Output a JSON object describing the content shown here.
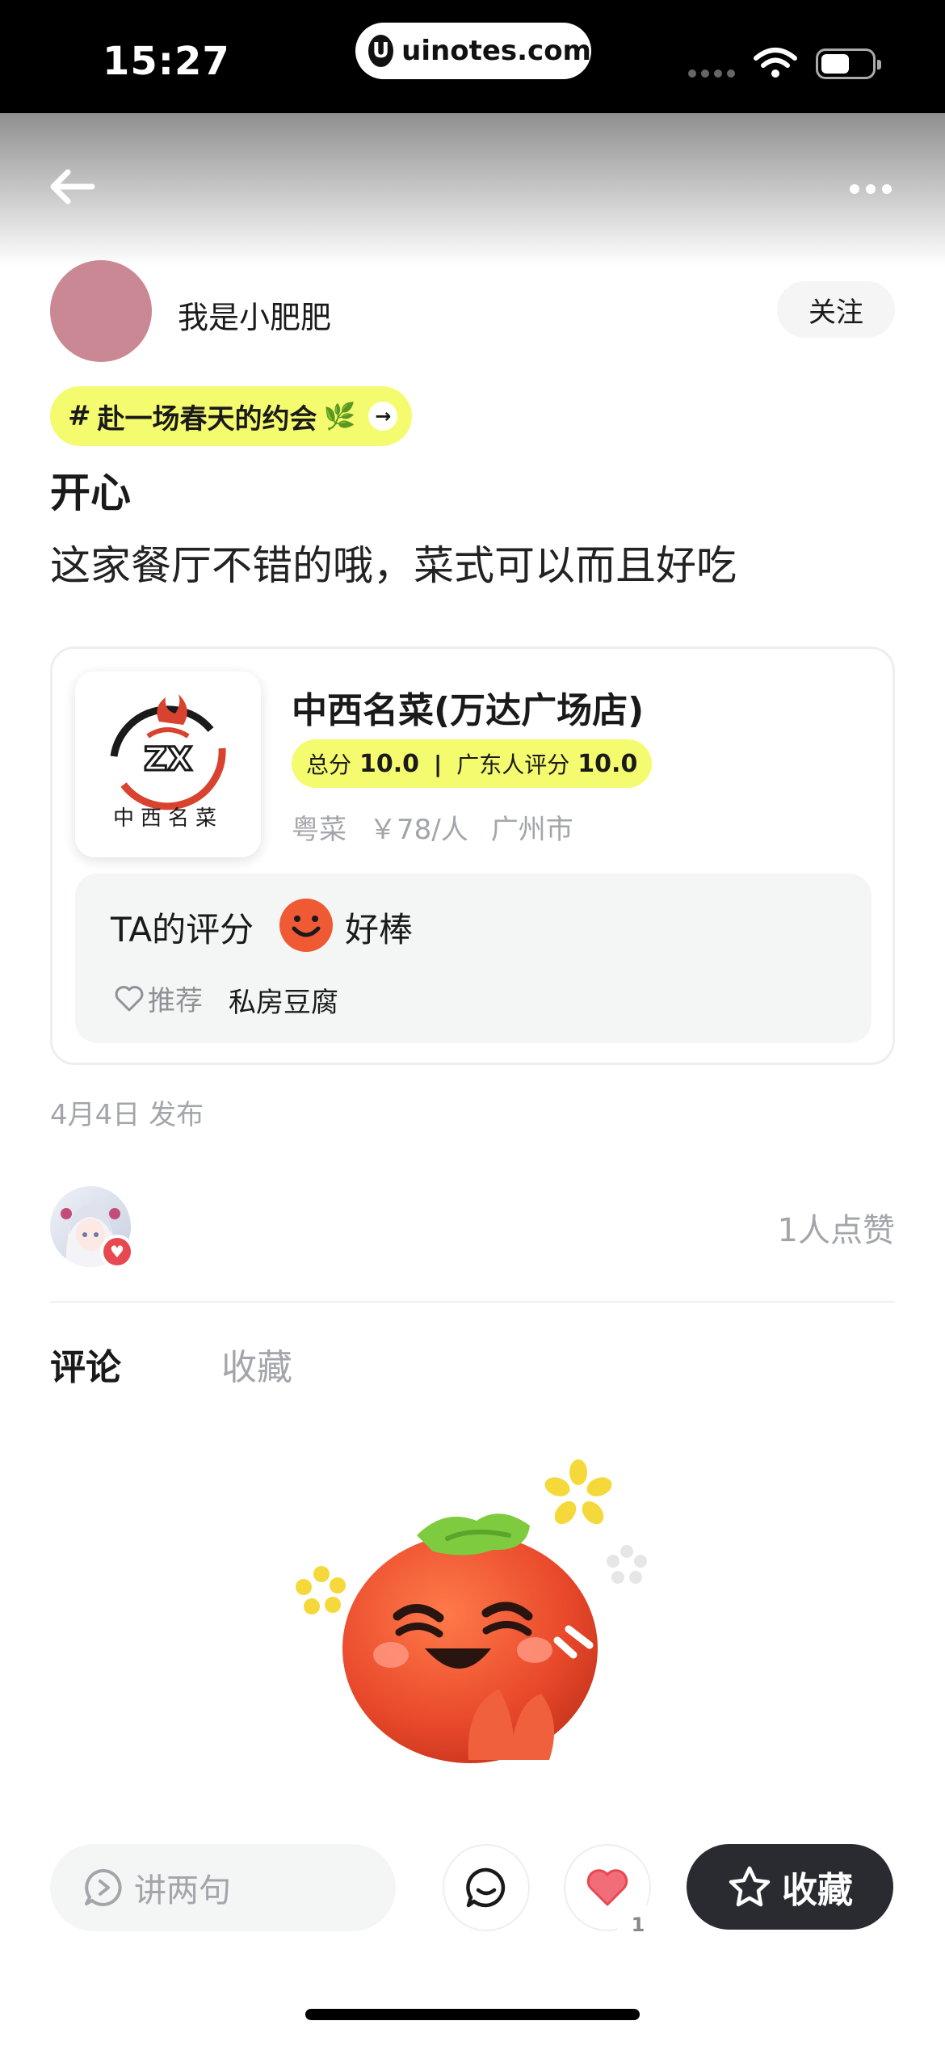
{
  "status_bar": {
    "time": "15:27",
    "url": "uinotes.com",
    "url_logo_letter": "U"
  },
  "nav": {
    "back_icon": "arrow-left-icon",
    "more_icon": "more-horizontal-icon"
  },
  "author": {
    "username": "我是小肥肥",
    "follow_label": "关注",
    "avatar_color": "#c98893"
  },
  "topic": {
    "hash": "#",
    "label": "赴一场春天的约会",
    "emoji": "🌿"
  },
  "post": {
    "title": "开心",
    "body": "这家餐厅不错的哦，菜式可以而且好吃",
    "publish_date": "4月4日 发布"
  },
  "restaurant": {
    "logo_text": "ZX",
    "logo_subtext": "中西名菜",
    "name": "中西名菜(万达广场店)",
    "total_score_label": "总分",
    "total_score": "10.0",
    "local_score_label": "广东人评分",
    "local_score": "10.0",
    "cuisine": "粤菜",
    "price": "￥78/人",
    "city": "广州市",
    "review_label": "TA的评分",
    "review_rating_word": "好棒",
    "recommend_label": "推荐",
    "recommended_dish": "私房豆腐"
  },
  "likes": {
    "count_label": "1人点赞"
  },
  "tabs": [
    {
      "label": "评论",
      "active": true
    },
    {
      "label": "收藏",
      "active": false
    }
  ],
  "bottom_bar": {
    "comment_placeholder": "讲两句",
    "like_count": "1",
    "favorite_label": "收藏"
  },
  "colors": {
    "accent_yellow": "#f5fb6e",
    "smile_orange": "#ef5a35",
    "heart_red": "#e8484f",
    "dark_button": "#2a2b31"
  }
}
